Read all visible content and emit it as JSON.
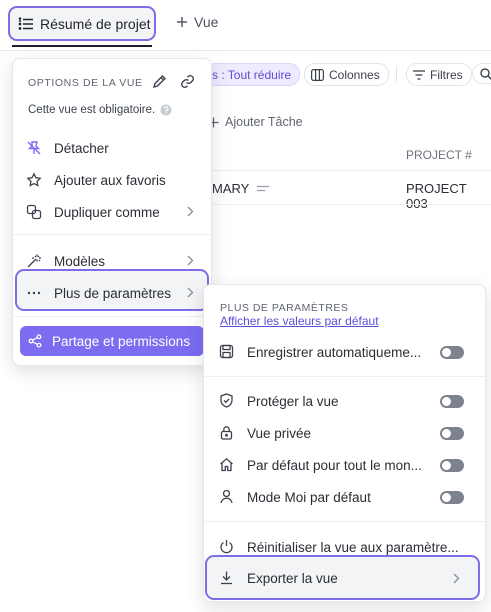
{
  "tabs": {
    "active_label": "Résumé de projet",
    "add_label": "Vue"
  },
  "toolbar": {
    "collapse_label": "s : Tout réduire",
    "columns_label": "Colonnes",
    "filters_label": "Filtres",
    "add_task_label": "Ajouter Tâche"
  },
  "table": {
    "column_header": "PROJECT #",
    "row": {
      "name": "MARY",
      "project": "PROJECT 003"
    }
  },
  "view_menu": {
    "title": "OPTIONS DE LA VUE",
    "description": "Cette vue est obligatoire.",
    "items": {
      "detach": "Détacher",
      "favorites": "Ajouter aux favoris",
      "duplicate": "Dupliquer comme",
      "templates": "Modèles",
      "more_params": "Plus de paramètres",
      "share": "Partage et permissions"
    }
  },
  "settings_menu": {
    "title": "PLUS DE PARAMÈTRES",
    "defaults_link": "Afficher les valeurs par défaut",
    "items": {
      "autosave": "Enregistrer automatiqueme...",
      "protect": "Protéger la vue",
      "private": "Vue privée",
      "default_all": "Par défaut pour tout le mon...",
      "me_mode": "Mode Moi par défaut",
      "reset": "Réinitialiser la vue aux paramètre...",
      "export": "Exporter la vue"
    },
    "toggles": {
      "autosave": false,
      "protect": false,
      "private": false,
      "default_all": false,
      "me_mode": false
    }
  },
  "colors": {
    "accent": "#7b6cf0",
    "highlight_border": "#7c6ee6",
    "toggle_off": "#7d838e"
  }
}
